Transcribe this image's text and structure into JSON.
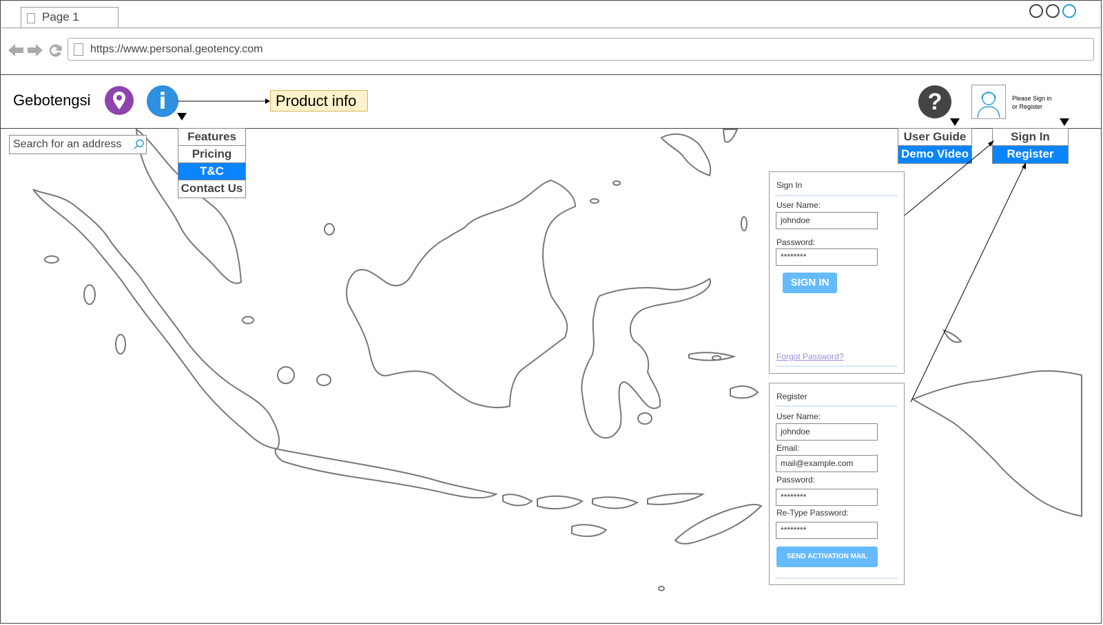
{
  "browser": {
    "tab_label": "Page 1",
    "url": "https://www.personal.geotency.com"
  },
  "header": {
    "app_title": "Gebotengsi",
    "product_info": "Product info",
    "sign_hint_line1": "Please Sign in",
    "sign_hint_line2": "or Register",
    "info_glyph": "i",
    "help_glyph": "?"
  },
  "search": {
    "placeholder": "Search for an address"
  },
  "product_menu": {
    "items": [
      "Features",
      "Pricing",
      "T&C",
      "Contact Us"
    ],
    "selected": "T&C"
  },
  "help_menu": {
    "items": [
      "User Guide",
      "Demo Video"
    ],
    "selected": "Demo Video"
  },
  "account_menu": {
    "items": [
      "Sign In",
      "Register"
    ],
    "selected": "Register"
  },
  "signin": {
    "title": "Sign In",
    "username_label": "User Name:",
    "username_value": "johndoe",
    "password_label": "Password:",
    "password_value": "********",
    "button": "SIGN IN",
    "forgot": "Forgot Password?"
  },
  "register": {
    "title": "Register",
    "username_label": "User Name:",
    "username_value": "johndoe",
    "email_label": "Email:",
    "email_value": "mail@example.com",
    "password_label": "Password:",
    "password_value": "********",
    "retype_label": "Re-Type Password:",
    "retype_value": "********",
    "button": "SEND ACTIVATION MAIL"
  },
  "colors": {
    "accent": "#0a84ff",
    "button": "#66bbff",
    "location_icon": "#8e44ad",
    "info_icon": "#2f8fe0",
    "note_bg": "#fff2cc"
  },
  "icons": [
    "back-arrow-icon",
    "forward-arrow-icon",
    "reload-icon",
    "page-icon",
    "location-pin-icon",
    "info-icon",
    "help-icon",
    "user-avatar-icon",
    "search-icon",
    "dropdown-arrow-icon"
  ]
}
